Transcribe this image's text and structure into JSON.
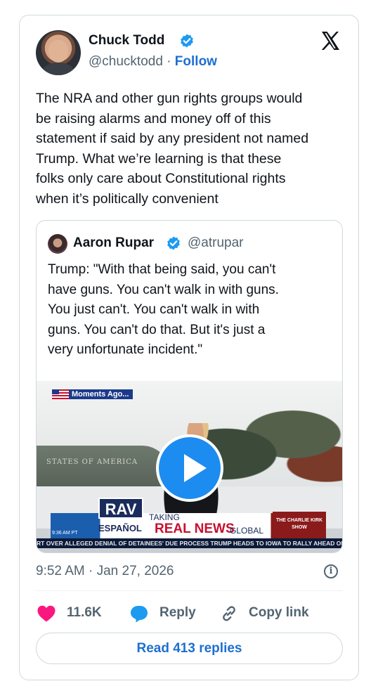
{
  "tweet": {
    "author_name": "Chuck Todd",
    "handle": "@chucktodd",
    "separator": "·",
    "follow_label": "Follow",
    "text_lines": [
      "The NRA and other gun rights groups would",
      "be raising alarms and money off of this",
      "statement if said by any president not named",
      "Trump.  What we’re learning is that these",
      "folks only care about Constitutional rights",
      "when it’s politically convenient"
    ],
    "timestamp": "9:52 AM · Jan 27, 2026",
    "likes": "11.6K",
    "reply_label": "Reply",
    "copy_link_label": "Copy link",
    "read_replies_label": "Read 413 replies"
  },
  "quote": {
    "author_name": "Aaron Rupar",
    "handle": "@atrupar",
    "text_lines": [
      "Trump: \"With that being said, you can't",
      "have guns. You can't walk in with guns.",
      "You just can't. You can't walk in with",
      "guns. You can't do that. But it's just a",
      "very unfortunate incident.\""
    ],
    "video": {
      "moments_label": "Moments Ago...",
      "plane_text": "STATES OF AMERICA",
      "rav_label": "RAV",
      "espanol_label": "ESPAÑOL",
      "taking_label": "TAKING",
      "real_news_label": "REAL NEWS",
      "global_label": "GLOBAL",
      "charlie_label": "THE CHARLIE KIRK SHOW",
      "clock_label": "9:36 AM PT",
      "ticker_text": "RT OVER ALLEGED DENIAL OF DETAINEES' DUE PROCESS      TRUMP HEADS TO IOWA TO RALLY AHEAD OF M"
    }
  },
  "colors": {
    "accent_blue": "#1d9bf0",
    "like_pink": "#f91880",
    "text_dark": "#0f1419",
    "text_gray": "#536471"
  },
  "icons": {
    "x_logo": "x-logo-icon",
    "verified": "verified-badge-icon",
    "heart": "heart-icon",
    "reply": "reply-bubble-icon",
    "link": "link-icon",
    "info": "info-icon",
    "play": "play-icon"
  }
}
